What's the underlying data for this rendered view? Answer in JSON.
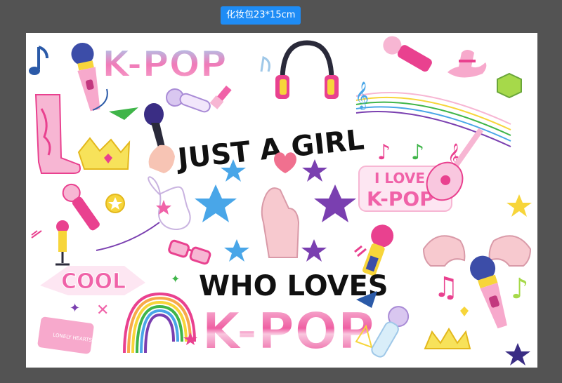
{
  "canvas": {
    "label": "化妆包23*15cm"
  },
  "design": {
    "headline_top": "JUST A GIRL",
    "headline_mid": "WHO LOVES",
    "kpop_main": "K-POP",
    "kpop_logo": "K-POP",
    "kpop_badge_top": "I LOVE",
    "kpop_badge_bottom": "K-POP",
    "cool_sticker": "COOL",
    "ticket_text": "LONELY HEARTS CLUB"
  },
  "colors": {
    "background": "#535353",
    "label_bg": "#1e8cf5",
    "pink": "#f062a8",
    "light_pink": "#f7b6d3",
    "purple": "#7a3fb0",
    "blue": "#49a6e8",
    "yellow": "#f7d53a",
    "green": "#3fb549"
  }
}
